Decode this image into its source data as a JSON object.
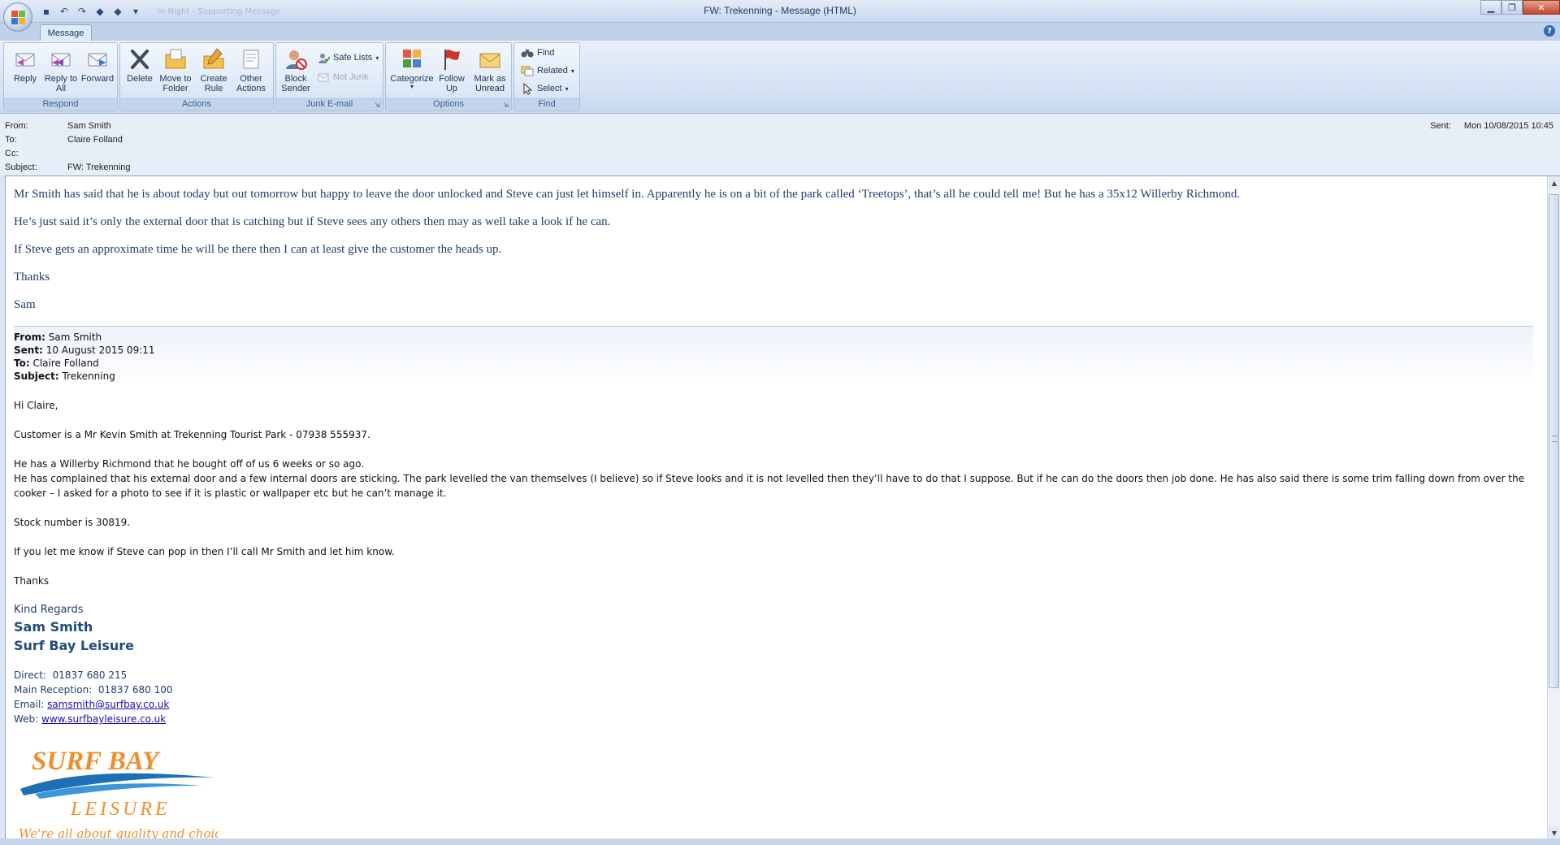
{
  "window": {
    "title": "FW: Trekenning - Message (HTML)",
    "qat_faded_text": "In Night - Supporting Message"
  },
  "tabs": [
    {
      "label": "Message"
    }
  ],
  "ribbon": {
    "respond": {
      "label": "Respond",
      "reply": "Reply",
      "reply_all": "Reply to All",
      "forward": "Forward"
    },
    "actions": {
      "label": "Actions",
      "delete": "Delete",
      "move_to_folder": "Move to Folder",
      "create_rule": "Create Rule",
      "other_actions": "Other Actions"
    },
    "junk": {
      "label": "Junk E-mail",
      "block_sender": "Block Sender",
      "safe_lists": "Safe Lists",
      "not_junk": "Not Junk"
    },
    "options": {
      "label": "Options",
      "categorize": "Categorize",
      "follow_up": "Follow Up",
      "mark_as_unread": "Mark as Unread"
    },
    "find": {
      "label": "Find",
      "find": "Find",
      "related": "Related",
      "select": "Select"
    }
  },
  "header": {
    "from_label": "From:",
    "from": "Sam Smith",
    "to_label": "To:",
    "to": "Claire Folland",
    "cc_label": "Cc:",
    "cc": "",
    "subject_label": "Subject:",
    "subject": "FW: Trekenning",
    "sent_label": "Sent:",
    "sent": "Mon 10/08/2015 10:45"
  },
  "body": {
    "top_paragraphs": [
      "Mr Smith has said that he is about today but out tomorrow but happy to leave the door unlocked and Steve can just let himself in. Apparently he is on a bit of the park called ‘Treetops’, that’s all he could tell me! But he has a 35x12 Willerby Richmond.",
      "He’s just said it’s only the external door that is catching but if Steve sees any others then may as well take a look if he can.",
      "If Steve gets an approximate time he will be there then I can at least give the customer the heads up.",
      "Thanks",
      "Sam"
    ],
    "forwarded": {
      "from_label": "From:",
      "from": "Sam Smith",
      "sent_label": "Sent:",
      "sent": "10 August 2015 09:11",
      "to_label": "To:",
      "to": "Claire Folland",
      "subject_label": "Subject:",
      "subject": "Trekenning"
    },
    "greeting": "Hi Claire,",
    "p1": "Customer is a Mr Kevin Smith at Trekenning Tourist Park - 07938 555937.",
    "p2a": "He has a Willerby Richmond that he bought off of us 6 weeks or so ago.",
    "p2b": "He has complained that his external door and a few internal doors are sticking. The park levelled the van themselves (I believe) so if Steve looks and it is not levelled then they’ll have to do that I suppose. But if he can do the doors then job done. He has also said there is some trim falling down from over the cooker – I asked for a photo to see if it is plastic or wallpaper etc but he can’t manage it.",
    "p3": "Stock number is 30819.",
    "p4": "If you let me know if Steve can pop in then I’ll call Mr Smith and let him know.",
    "thanks": "Thanks",
    "signature": {
      "regards": "Kind Regards",
      "name": "Sam Smith",
      "company": "Surf Bay Leisure",
      "direct_label": "Direct:",
      "direct": "01837 680 215",
      "reception_label": "Main Reception:",
      "reception": "01837 680 100",
      "email_label": "Email:",
      "email": "samsmith@surfbay.co.uk",
      "web_label": "Web:",
      "web": "www.surfbayleisure.co.uk"
    },
    "logo": {
      "line1": "SURF BAY",
      "line2": "LEISURE",
      "tagline": "We're all about quality and choice!"
    }
  }
}
